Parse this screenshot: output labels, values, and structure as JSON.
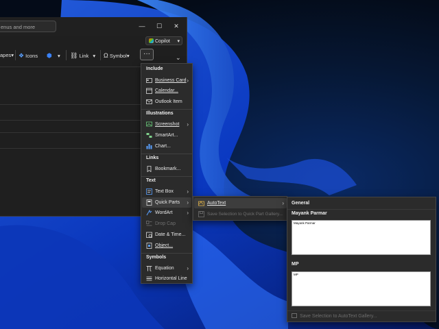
{
  "window": {
    "search_placeholder": "enus and more",
    "minimize_glyph": "—",
    "maximize_glyph": "☐",
    "close_glyph": "✕",
    "copilot_label": "Copilot",
    "copilot_chevron": "▾",
    "ribbon": {
      "shapes_label": "apes",
      "icons_label": "Icons",
      "link_label": "Link",
      "symbol_label": "Symbol",
      "more_label": "···",
      "caret": "▾",
      "collapse": "⌄"
    }
  },
  "menu": {
    "sections": {
      "include": "Include",
      "illustrations": "Illustrations",
      "links": "Links",
      "text": "Text",
      "symbols": "Symbols"
    },
    "items": {
      "business_card": "Business Card",
      "calendar": "Calendar...",
      "outlook_item": "Outlook Item",
      "screenshot": "Screenshot",
      "smartart": "SmartArt...",
      "chart": "Chart...",
      "bookmark": "Bookmark...",
      "text_box": "Text Box",
      "quick_parts": "Quick Parts",
      "wordart": "WordArt",
      "drop_cap": "Drop Cap",
      "date_time": "Date & Time...",
      "object": "Object...",
      "equation": "Equation",
      "horizontal_line": "Horizontal Line"
    },
    "arrow": "›"
  },
  "quick_parts_menu": {
    "autotext": "AutoText",
    "save_selection": "Save Selection to Quick Part Gallery..."
  },
  "autotext_gallery": {
    "header": "General",
    "entries": [
      {
        "name": "Mayank Parmar",
        "preview": "Mayank Parmar"
      },
      {
        "name": "MP",
        "preview": "MP"
      }
    ],
    "footer": "Save Selection to AutoText Gallery..."
  }
}
